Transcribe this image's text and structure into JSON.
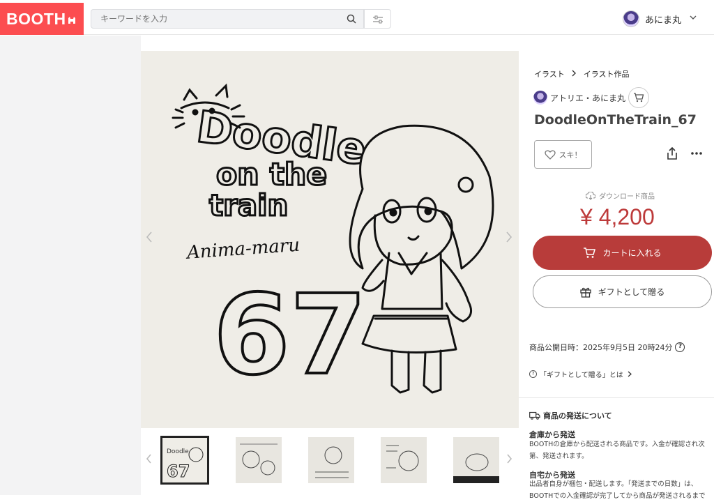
{
  "header": {
    "logo": "BOOTH",
    "search_placeholder": "キーワードを入力",
    "user_name": "あにま丸"
  },
  "breadcrumb": {
    "items": [
      "イラスト",
      "イラスト作品"
    ]
  },
  "shop": {
    "name": "アトリエ・あにま丸"
  },
  "product": {
    "title": "DoodleOnTheTrain_67",
    "like_label": "スキ！",
    "type_label": "ダウンロード商品",
    "price": "¥ 4,200",
    "cart_label": "カートに入れる",
    "gift_label": "ギフトとして贈る",
    "published": "商品公開日時：2025年9月5日 20時24分",
    "gift_about": "「ギフトとして贈る」とは"
  },
  "artwork": {
    "line1": "Doodle",
    "line2": "on the",
    "line3": "train",
    "signature": "Anima-maru",
    "number": "67"
  },
  "shipping": {
    "heading": "商品の発送について",
    "warehouse_title": "倉庫から発送",
    "warehouse_desc_1": "BOOTHの倉庫から配送される商品です。入金が確認され次",
    "warehouse_desc_2": "第、発送されます。",
    "self_title": "自宅から発送",
    "self_desc_1": "出品者自身が梱包・配送します。「発送までの日数」は、",
    "self_desc_2": "BOOTHでの入金確認が完了してから商品が発送されるまで"
  },
  "colors": {
    "brand": "#fc4d50",
    "cart": "#b83c3a",
    "price": "#bd3a3a"
  },
  "icons": [
    "search-icon",
    "filter-icon",
    "chevron-down-icon",
    "cart-icon",
    "heart-icon",
    "share-icon",
    "more-icon",
    "download-icon",
    "gift-icon",
    "question-icon",
    "truck-icon"
  ]
}
